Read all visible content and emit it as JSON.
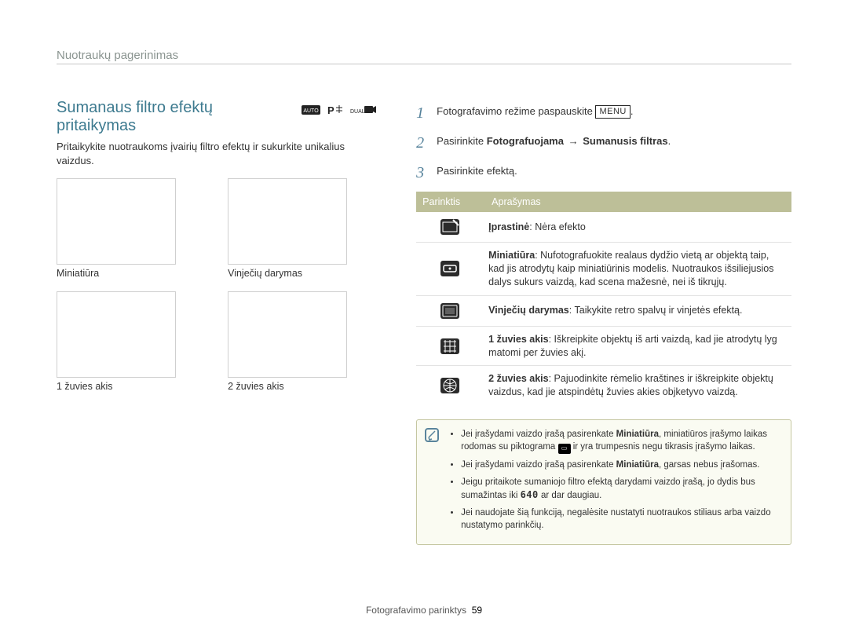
{
  "header": "Nuotraukų pagerinimas",
  "title": "Sumanaus ﬁltro efektų pritaikymas",
  "subtitle": "Pritaikykite nuotraukoms įvairių ﬁltro efektų ir sukurkite unikalius vaizdus.",
  "thumbs": [
    {
      "caption": "Miniatiūra"
    },
    {
      "caption": "Vinječių darymas"
    },
    {
      "caption": "1 žuvies akis"
    },
    {
      "caption": "2 žuvies akis"
    }
  ],
  "steps": [
    {
      "n": "1",
      "prefix": "Fotografavimo režime paspauskite ",
      "menu": "MENU",
      "suffix": "."
    },
    {
      "n": "2",
      "text_before": "Pasirinkite ",
      "bold1": "Fotografuojama",
      "arrow": "→",
      "bold2": "Sumanusis ﬁltras",
      "text_after": "."
    },
    {
      "n": "3",
      "plain": "Pasirinkite efektą."
    }
  ],
  "table_head": {
    "c1": "Parinktis",
    "c2": "Aprašymas"
  },
  "rows": [
    {
      "title": "Įprastinė",
      "desc": ": Nėra efekto"
    },
    {
      "title": "Miniatiūra",
      "desc": ": Nufotografuokite realaus dydžio vietą ar objektą taip, kad jis atrodytų kaip miniatiūrinis modelis. Nuotraukos išsiliejusios dalys sukurs vaizdą, kad scena mažesnė, nei iš tikrųjų."
    },
    {
      "title": "Vinječių darymas",
      "desc": ": Taikykite retro spalvų ir vinjetės efektą."
    },
    {
      "title": "1 žuvies akis",
      "desc": ": Iškreipkite objektų iš arti vaizdą, kad jie atrodytų lyg matomi per žuvies akį."
    },
    {
      "title": "2 žuvies akis",
      "desc": ": Pajuodinkite rėmelio kraštines ir iškreipkite objektų vaizdus, kad jie atspindėtų žuvies akies objketyvo vaizdą."
    }
  ],
  "notes": [
    {
      "pre": "Jei įrašydami vaizdo įrašą pasirenkate ",
      "b": "Miniatiūra",
      "post": ", miniatiūros įrašymo laikas rodomas su piktograma ",
      "post2": " ir yra trumpesnis negu tikrasis įrašymo laikas."
    },
    {
      "pre": "Jei įrašydami vaizdo įrašą pasirenkate ",
      "b": "Miniatiūra",
      "post": ", garsas nebus įrašomas."
    },
    {
      "plain_pre": "Jeigu pritaikote sumaniojo ﬁltro efektą darydami vaizdo įrašą, jo dydis bus sumažintas iki ",
      "code": "640",
      "plain_post": " ar dar daugiau."
    },
    {
      "plain": "Jei naudojate šią funkciją, negalėsite nustatyti nuotraukos stiliaus arba vaizdo nustatymo parinkčių."
    }
  ],
  "footer": {
    "section": "Fotografavimo parinktys",
    "page": "59"
  }
}
